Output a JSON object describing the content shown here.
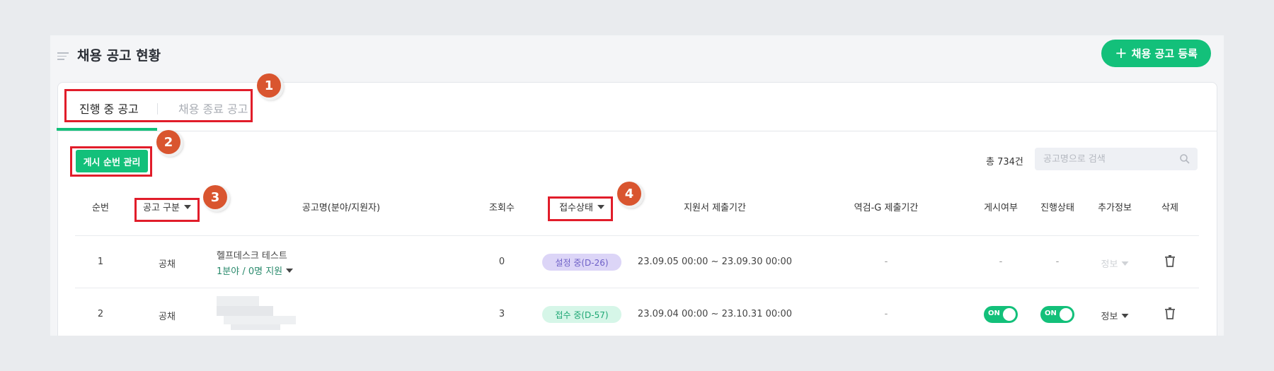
{
  "header": {
    "title": "채용 공고 현황",
    "register_button": "채용 공고 등록"
  },
  "tabs": [
    {
      "label": "진행 중 공고",
      "active": true
    },
    {
      "label": "채용 종료 공고",
      "active": false
    }
  ],
  "toolbar": {
    "order_button": "게시 순번 관리",
    "total_count": "총 734건",
    "search_placeholder": "공고명으로 검색"
  },
  "annotations": [
    "1",
    "2",
    "3",
    "4"
  ],
  "table": {
    "headers": {
      "no": "순번",
      "type": "공고 구분",
      "name": "공고명(분야/지원자)",
      "views": "조회수",
      "status": "접수상태",
      "period": "지원서 제출기간",
      "g_period": "역검-G 제출기간",
      "posted": "게시여부",
      "progress": "진행상태",
      "extra": "추가정보",
      "delete": "삭제"
    },
    "rows": [
      {
        "no": "1",
        "type": "공채",
        "name": "헬프데스크 테스트",
        "sub": "1분야 / 0명 지원",
        "views": "0",
        "status": "설정 중(D-26)",
        "period": "23.09.05 00:00 ~ 23.09.30 00:00",
        "g_period": "-",
        "posted": "-",
        "progress": "-",
        "extra": "정보"
      },
      {
        "no": "2",
        "type": "공채",
        "name": "",
        "sub": "",
        "views": "3",
        "status": "접수 중(D-57)",
        "period": "23.09.04 00:00 ~ 23.10.31 00:00",
        "g_period": "-",
        "posted_toggle": "ON",
        "progress_toggle": "ON",
        "extra": "정보"
      }
    ]
  },
  "colors": {
    "accent": "#13c07a",
    "annotation_box": "#e11d2a",
    "annotation_badge": "#d9552f"
  }
}
